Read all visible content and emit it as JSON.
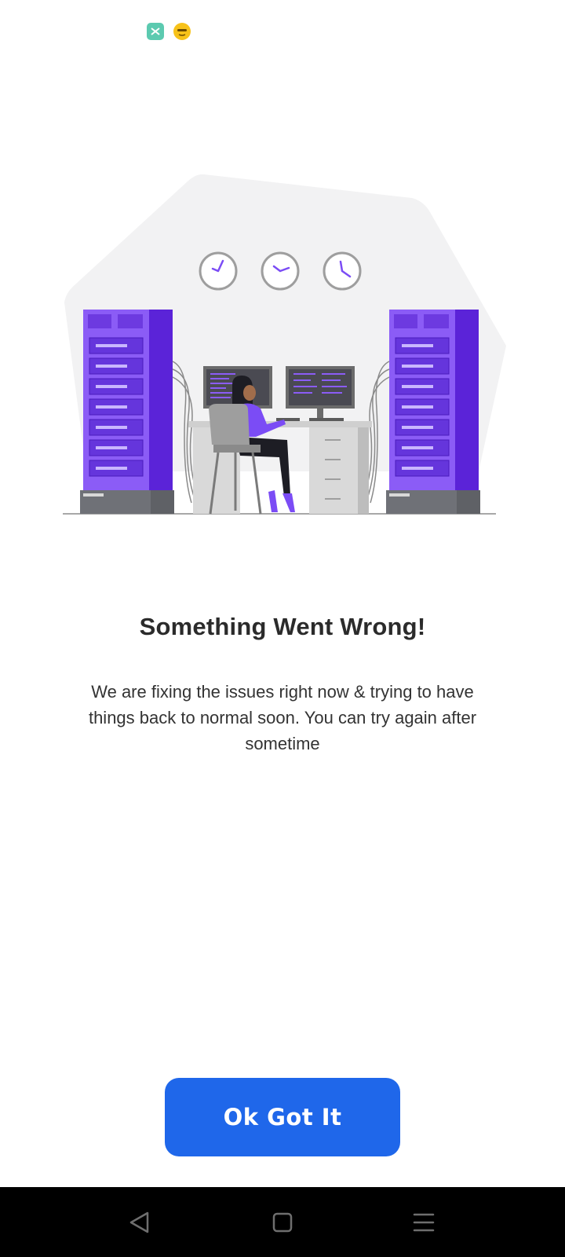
{
  "status_bar": {
    "icons": [
      "app-notification-icon",
      "emoji-notification-icon"
    ]
  },
  "illustration": {
    "description_icon": "server-room-illustration"
  },
  "error": {
    "title": "Something Went Wrong!",
    "message": "We are fixing the issues right now & trying to have things back to normal soon. You can try again after sometime"
  },
  "actions": {
    "ok_label": "Ok Got It"
  },
  "nav_bar": {
    "buttons": [
      "back-icon",
      "home-icon",
      "menu-icon"
    ]
  },
  "colors": {
    "accent": "#1f67ea",
    "illustration_purple": "#7b4cf5",
    "nav_bg": "#000000"
  }
}
